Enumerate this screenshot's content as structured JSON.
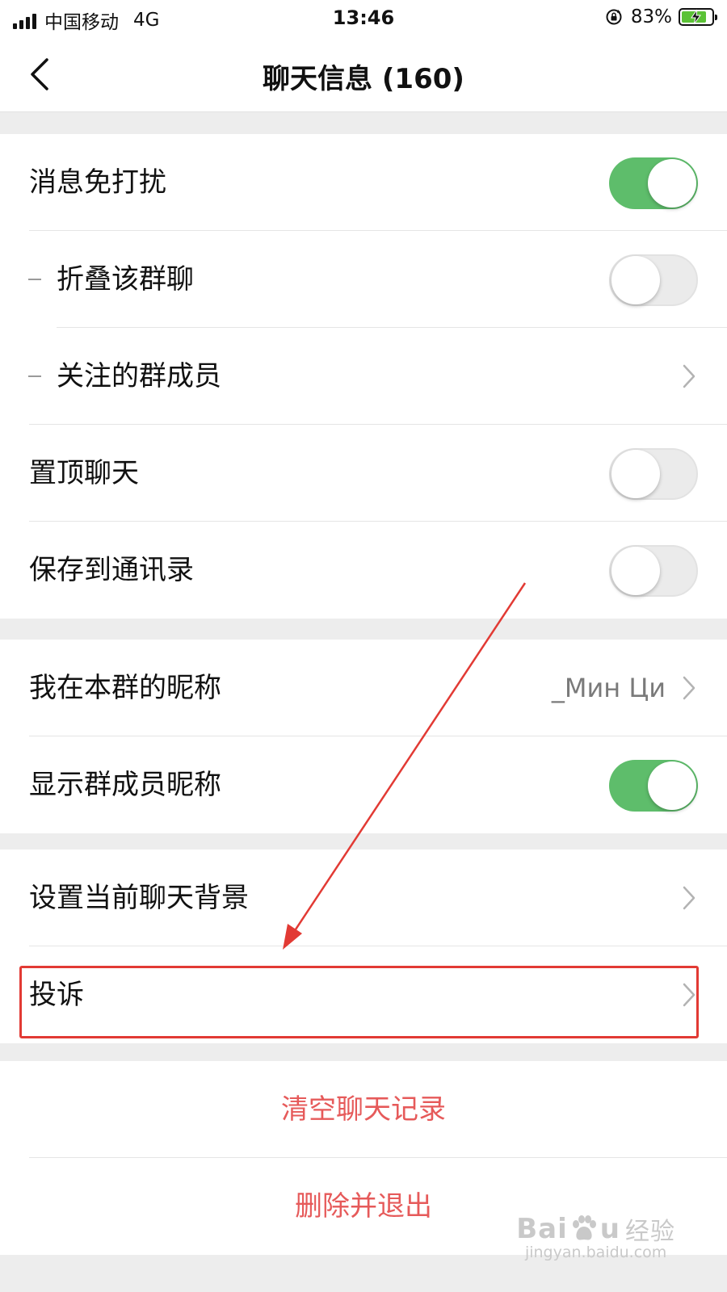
{
  "status_bar": {
    "carrier": "中国移动",
    "network": "4G",
    "time": "13:46",
    "battery": "83%",
    "battery_level": 0.83
  },
  "nav": {
    "title": "聊天信息 (160)",
    "back_icon": "chevron-left-icon"
  },
  "group1": {
    "mute": {
      "label": "消息免打扰",
      "on": true
    },
    "fold": {
      "label": "折叠该群聊",
      "on": false
    },
    "followed": {
      "label": "关注的群成员"
    },
    "pin": {
      "label": "置顶聊天",
      "on": false
    },
    "save_contacts": {
      "label": "保存到通讯录",
      "on": false
    }
  },
  "group2": {
    "nickname": {
      "label": "我在本群的昵称",
      "value": "_Мин Ци"
    },
    "show_nicknames": {
      "label": "显示群成员昵称",
      "on": true
    }
  },
  "group3": {
    "background": {
      "label": "设置当前聊天背景"
    },
    "complain": {
      "label": "投诉"
    }
  },
  "group4": {
    "clear": "清空聊天记录",
    "delete_exit": "删除并退出"
  },
  "watermark": {
    "brand": "Bai",
    "brand_end": "u",
    "suffix": "经验",
    "url": "jingyan.baidu.com"
  },
  "colors": {
    "toggle_on": "#5ebd6b",
    "danger": "#e65a5a",
    "annotation": "#e23a34"
  }
}
